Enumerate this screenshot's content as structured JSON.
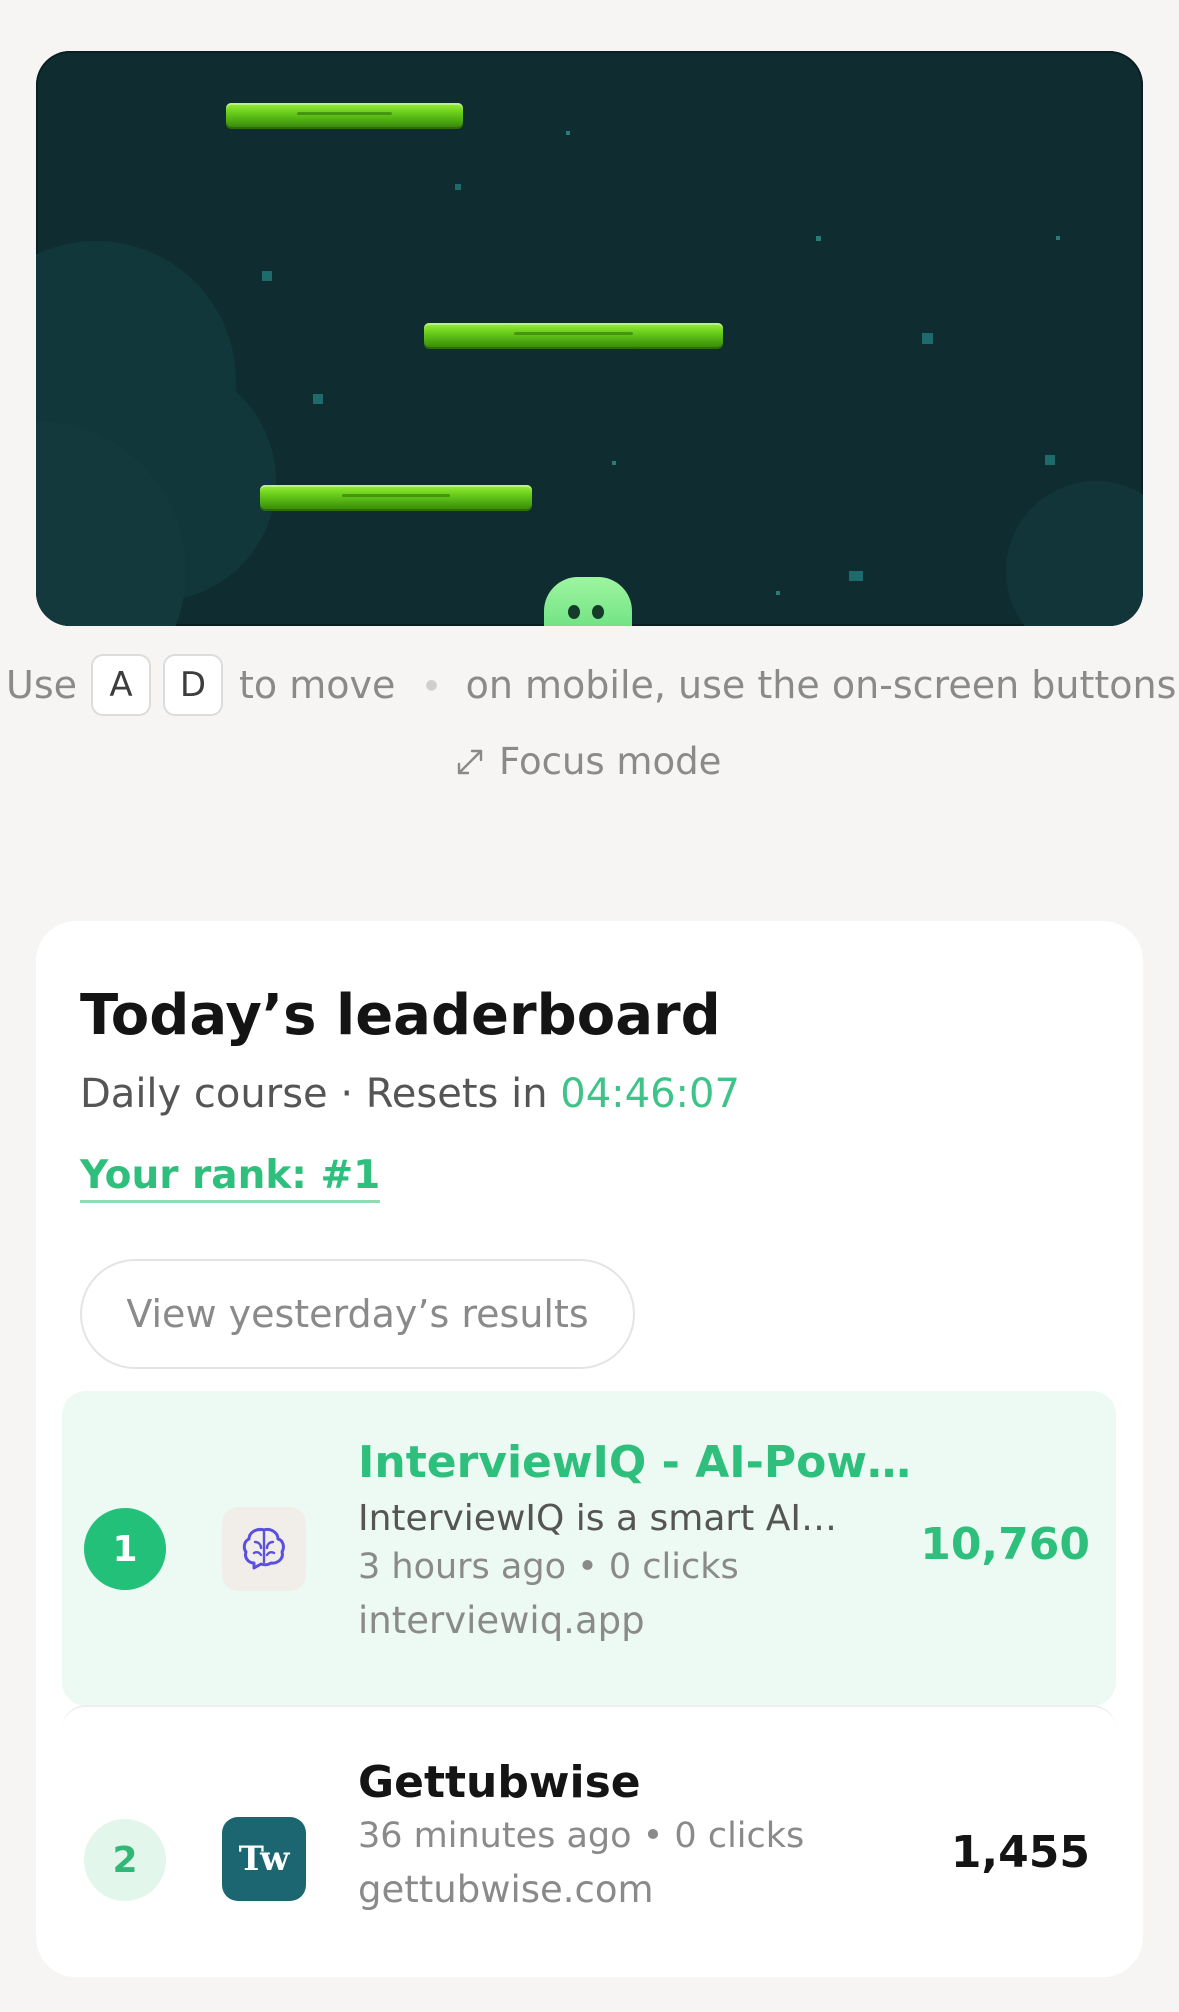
{
  "game": {
    "platforms": 3,
    "player": "green blob"
  },
  "controls": {
    "use_label": "Use",
    "key_left": "A",
    "key_right": "D",
    "move_label": "to move",
    "mobile_hint": "on mobile, use the on-screen buttons",
    "focus_mode_label": "Focus mode"
  },
  "leaderboard": {
    "title": "Today’s leaderboard",
    "subtitle_prefix": "Daily course · Resets in ",
    "reset_timer": "04:46:07",
    "your_rank": "Your rank: #1",
    "yesterday_button": "View yesterday’s results",
    "entries": [
      {
        "rank": "1",
        "name": "InterviewIQ - AI-Power…",
        "description": "InterviewIQ is a smart AI-…",
        "meta": "3 hours ago • 0 clicks",
        "domain": "interviewiq.app",
        "score": "10,760",
        "logo_icon": "brain-icon",
        "highlight_color": "#ecfaf3"
      },
      {
        "rank": "2",
        "name": "Gettubwise",
        "meta": "36 minutes ago • 0 clicks",
        "domain": "gettubwise.com",
        "score": "1,455",
        "logo_text": "Tw",
        "logo_color": "#1c6671"
      }
    ]
  },
  "colors": {
    "accent": "#2fbf7c",
    "game_bg": "#0f2d30",
    "platform": "#6fd21d",
    "page_bg": "#f6f5f3"
  }
}
